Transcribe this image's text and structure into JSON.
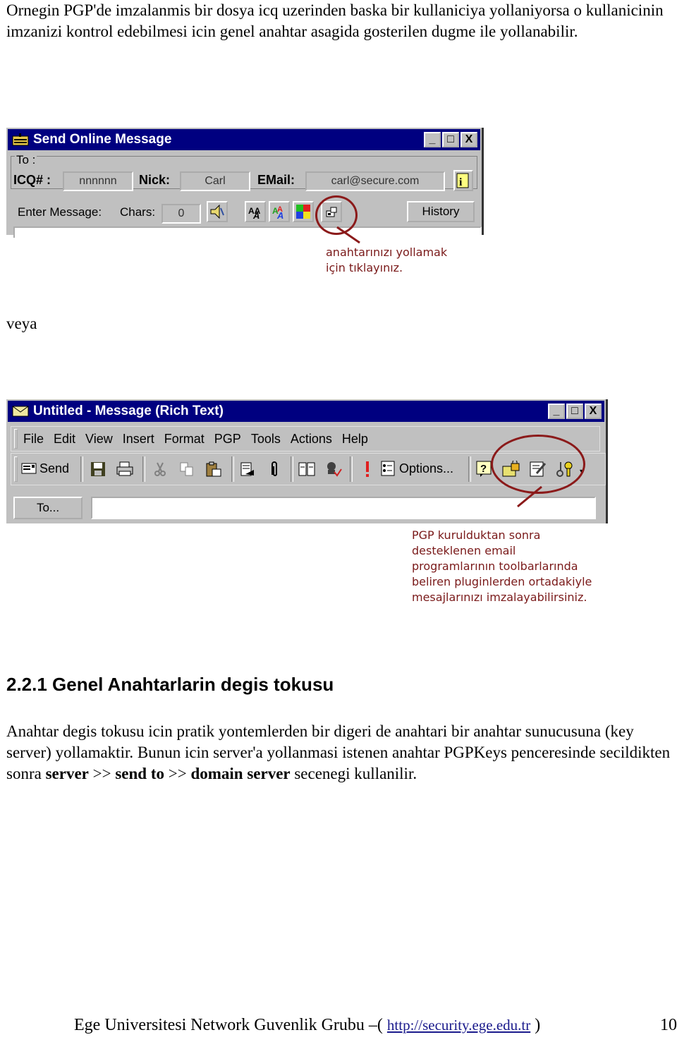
{
  "intro": {
    "text": "Ornegin PGP'de imzalanmis bir dosya icq uzerinden baska bir kullaniciya yollaniyorsa o kullanicinin imzanizi kontrol edebilmesi icin genel anahtar asagida gosterilen dugme ile yollanabilir."
  },
  "icq_window": {
    "title": "Send Online Message",
    "window_buttons": {
      "minimize": "_",
      "maximize": "□",
      "close": "X"
    },
    "to_label": "To :",
    "icq_label": "ICQ# :",
    "icq_value": "nnnnnn",
    "nick_label": "Nick:",
    "nick_value": "Carl",
    "email_label": "EMail:",
    "email_value": "carl@secure.com",
    "enter_message_label": "Enter Message:",
    "chars_label": "Chars:",
    "chars_value": "0",
    "history_button": "History",
    "icons": [
      "info-icon",
      "sound-icon",
      "font-icon",
      "font-color-icon",
      "color-icon",
      "send-key-icon"
    ]
  },
  "icq_callout": {
    "line1": "anahtarınızı yollamak",
    "line2": "için tıklayınız."
  },
  "veya": "veya",
  "outlook_window": {
    "title": "Untitled - Message (Rich Text)",
    "window_buttons": {
      "minimize": "_",
      "maximize": "□",
      "close": "X"
    },
    "menu": [
      "File",
      "Edit",
      "View",
      "Insert",
      "Format",
      "PGP",
      "Tools",
      "Actions",
      "Help"
    ],
    "menu_accel": [
      "F",
      "E",
      "V",
      "I",
      "o",
      "P",
      "T",
      "A",
      "H"
    ],
    "send_button": "Send",
    "options_button": "Options...",
    "to_button": "To...",
    "to_value": "",
    "icons": [
      "send-icon",
      "save-icon",
      "print-icon",
      "cut-icon",
      "copy-icon",
      "paste-icon",
      "signature-icon",
      "attach-icon",
      "address-book-icon",
      "check-names-icon",
      "importance-icon",
      "options-icon",
      "help-icon",
      "pgp-encrypt-icon",
      "pgp-sign-icon",
      "pgp-keys-icon"
    ]
  },
  "outlook_callout": {
    "lines": [
      "PGP kurulduktan sonra",
      "desteklenen email",
      "programlarının toolbarlarında",
      "beliren pluginlerden ortadakiyle",
      "mesajlarınızı imzalayabilirsiniz."
    ]
  },
  "section": {
    "heading": "2.2.1  Genel Anahtarlarin degis tokusu",
    "body_part1": "Anahtar degis tokusu icin pratik yontemlerden bir digeri de anahtari bir anahtar sunucusuna (key server) yollamaktir. Bunun icin server'a yollanmasi istenen anahtar PGPKeys penceresinde secildikten sonra ",
    "bold1": "server",
    "sep1": " >> ",
    "bold2": "send to",
    "sep2": " >> ",
    "bold3": "domain server",
    "body_part2": " secenegi kullanilir."
  },
  "footer": {
    "text": "Ege Universitesi Network Guvenlik Grubu –( ",
    "link": "http://security.ege.edu.tr",
    "close": " )",
    "page_number": "10"
  },
  "colors": {
    "titlebar": "#000080",
    "window_face": "#c0c0c0",
    "annotation": "#8b1a1a"
  }
}
